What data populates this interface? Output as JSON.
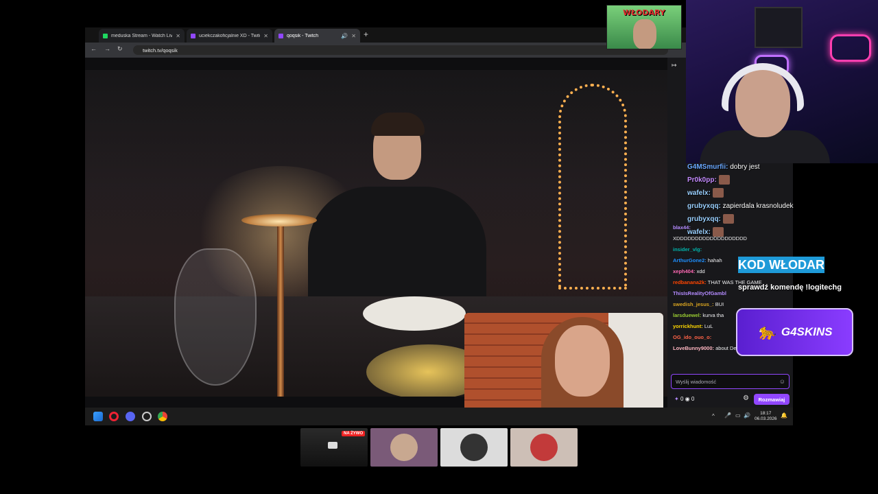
{
  "browser": {
    "tabs": [
      {
        "title": "meduska Stream - Watch Live o",
        "color": "#1ed760"
      },
      {
        "title": "uciekczakoficjalnie XD - Twitch",
        "color": "#9147ff"
      },
      {
        "title": "qoqsik - Twitch",
        "color": "#9147ff"
      }
    ],
    "url": "twitch.tv/qoqsik"
  },
  "chat": {
    "lines": [
      {
        "user": "blax44:",
        "text": "",
        "color": "#b48bff"
      },
      {
        "user": "",
        "text": "XDDDDDDDDDDDDDDDDDDD",
        "color": "#efeff1"
      },
      {
        "user": "insider_vlg:",
        "text": "",
        "color": "#00b5ad"
      },
      {
        "user": "ArthurGone2:",
        "text": "hahah",
        "color": "#1e90ff"
      },
      {
        "user": "xeph404:",
        "text": "xdd",
        "color": "#ff69b4"
      },
      {
        "user": "redbanana2k:",
        "text": "THAT WAS THE GAME",
        "color": "#ff4500"
      },
      {
        "user": "ThisIsRealityOfGambl",
        "text": "",
        "color": "#b48bff"
      },
      {
        "user": "swedish_jesus_:",
        "text": "BUI",
        "color": "#daa520"
      },
      {
        "user": "larsduewel:",
        "text": "kurva tha",
        "color": "#9acd32"
      },
      {
        "user": "yorrickhunt:",
        "text": "LuL",
        "color": "#ffd700"
      },
      {
        "user": "OG_ido_ouo_o:",
        "text": "",
        "color": "#ff6347"
      },
      {
        "user": "LoveBunny9000:",
        "text": "about DeezNuts",
        "color": "#ffb6c1"
      }
    ],
    "input_placeholder": "Wyślij wiadomość",
    "points": "0",
    "bits": "0",
    "send_label": "Rozmawiaj"
  },
  "taskbar": {
    "time": "18:17",
    "date": "06.03.2026"
  },
  "poster": {
    "text": "WŁODARY"
  },
  "overlay_chat": [
    {
      "user": "G4MSmurfii:",
      "text": "dobry jest",
      "color": "#6aa8ff"
    },
    {
      "user": "Pr0k0pp:",
      "text": "",
      "color": "#c48bff"
    },
    {
      "user": "wafelx:",
      "text": "",
      "color": "#9ad0ff"
    },
    {
      "user": "grubyxqq:",
      "text": "zapierdala krasnoludek",
      "color": "#9ad0ff"
    },
    {
      "user": "grubyxqq:",
      "text": "",
      "color": "#9ad0ff"
    },
    {
      "user": "wafelx:",
      "text": "",
      "color": "#9ad0ff"
    }
  ],
  "overlay": {
    "kod_banner": "KOD WŁODAR",
    "sprawdz": "sprawdź komendę !logitechg",
    "sponsor": "G4SKINS"
  },
  "participants": {
    "live_badge": "NA ŻYWO"
  }
}
